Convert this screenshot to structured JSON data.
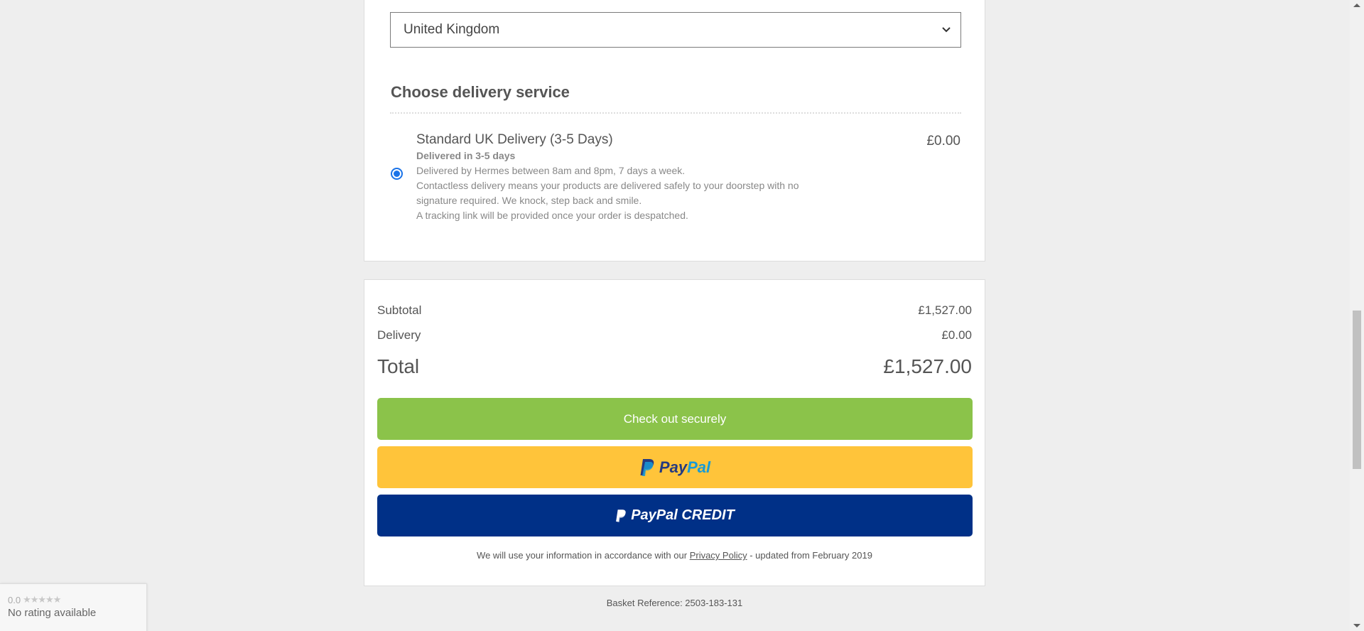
{
  "delivery": {
    "country_value": "United Kingdom",
    "section_title": "Choose delivery service",
    "option": {
      "name": "Standard UK Delivery (3-5 Days)",
      "price": "£0.00",
      "subtitle": "Delivered in 3-5 days",
      "lines": [
        "Delivered by Hermes between 8am and 8pm, 7 days a week.",
        "Contactless delivery means your products are delivered safely to your doorstep with no",
        "signature required. We knock, step back and smile.",
        "A tracking link will be provided once your order is despatched."
      ],
      "selected": true
    }
  },
  "summary": {
    "subtotal_label": "Subtotal",
    "subtotal_value": "£1,527.00",
    "delivery_label": "Delivery",
    "delivery_value": "£0.00",
    "total_label": "Total",
    "total_value": "£1,527.00",
    "checkout_label": "Check out securely",
    "paypal_pay": "Pay",
    "paypal_pal": "Pal",
    "paypal_credit_label": "PayPal CREDIT",
    "privacy_prefix": "We will use your information in accordance with our",
    "privacy_link": "Privacy Policy",
    "privacy_suffix": "- updated from February 2019"
  },
  "basket_reference": "Basket Reference: 2503-183-131",
  "rating": {
    "score": "0.0",
    "stars": "★★★★★",
    "text": "No rating available"
  },
  "colors": {
    "checkout": "#8bc34a",
    "paypal": "#ffc43a",
    "paypal_credit": "#003087",
    "radio": "#1a73e8"
  }
}
